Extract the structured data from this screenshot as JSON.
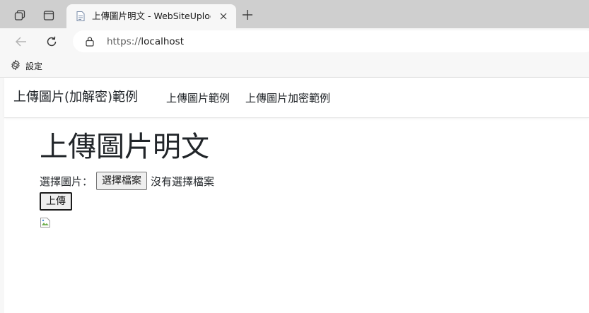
{
  "browser": {
    "tab": {
      "title": "上傳圖片明文 - WebSiteUplodaImage",
      "close_icon": "close-icon",
      "favicon": "page-icon"
    },
    "address_bar": {
      "protocol": "https://",
      "host": "localhost",
      "lock_icon": "lock-icon"
    },
    "favorites": [
      {
        "label": "設定",
        "icon": "gear-icon"
      }
    ]
  },
  "site": {
    "brand": "上傳圖片(加解密)範例",
    "nav": [
      {
        "label": "上傳圖片範例"
      },
      {
        "label": "上傳圖片加密範例"
      }
    ]
  },
  "main": {
    "heading": "上傳圖片明文",
    "file_label": "選擇圖片：",
    "file_button": "選擇檔案",
    "file_status": "沒有選擇檔案",
    "upload_button": "上傳"
  },
  "colors": {
    "tabstrip": "#cfcfcf",
    "toolbar": "#f7f7f7",
    "text": "#212529"
  }
}
